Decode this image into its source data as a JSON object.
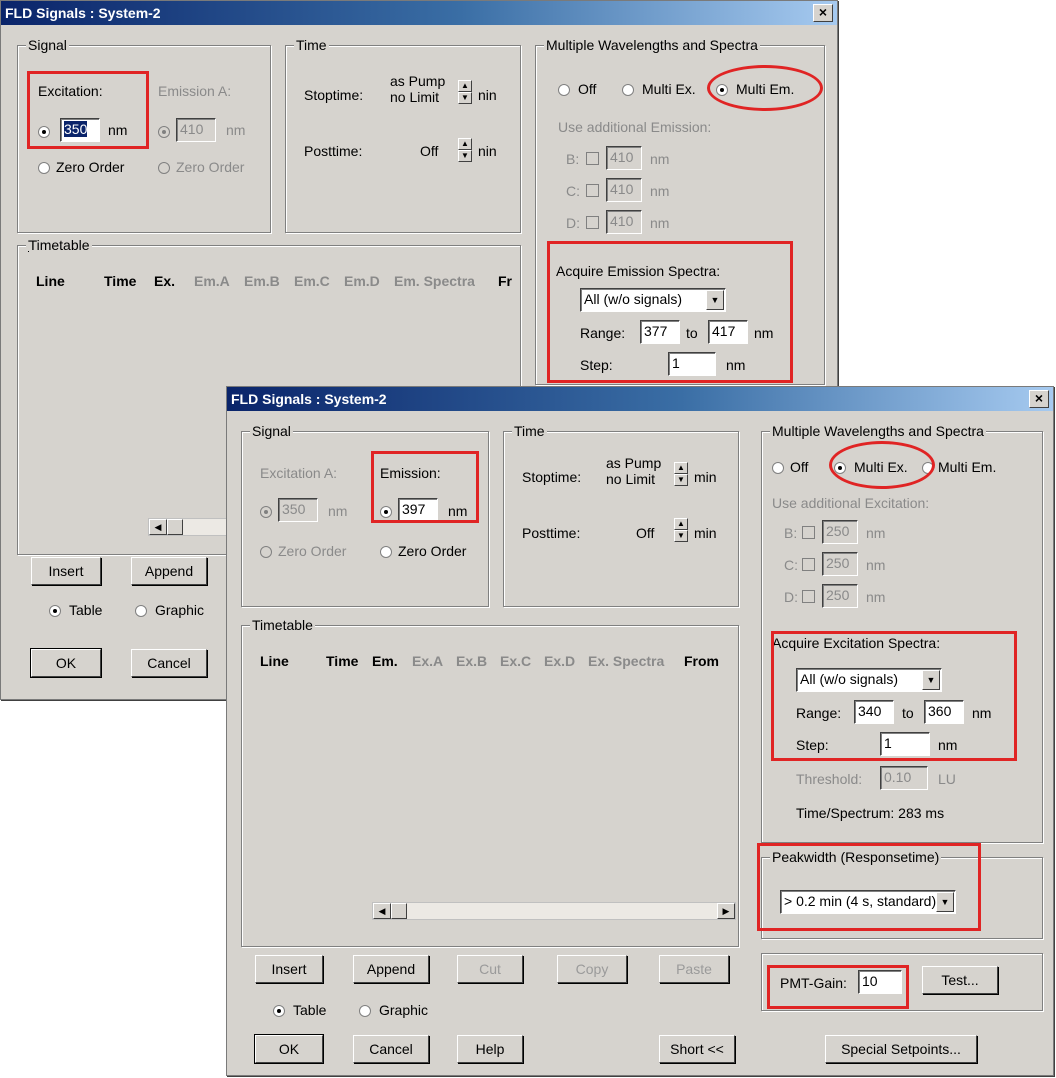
{
  "back_window": {
    "title": "FLD Signals : System-2",
    "close_glyph": "×",
    "signal": {
      "group": "Signal",
      "excitation_label": "Excitation:",
      "excitation_value": "350",
      "excitation_unit": "nm",
      "excitation_zero_order": "Zero Order",
      "emission_label": "Emission A:",
      "emission_value": "410",
      "emission_unit": "nm",
      "emission_zero_order": "Zero Order"
    },
    "time": {
      "group": "Time",
      "stoptime_label": "Stoptime:",
      "stoptime_value_1": "as Pump",
      "stoptime_value_2": "no Limit",
      "stoptime_unit": "nin",
      "posttime_label": "Posttime:",
      "posttime_value": "Off",
      "posttime_unit": "nin"
    },
    "multi": {
      "group": "Multiple Wavelengths and Spectra",
      "opt_off": "Off",
      "opt_multi_ex": "Multi Ex.",
      "opt_multi_em": "Multi Em.",
      "use_additional": "Use additional Emission:",
      "b_label": "B:",
      "c_label": "C:",
      "d_label": "D:",
      "b_value": "410",
      "c_value": "410",
      "d_value": "410",
      "unit": "nm",
      "acquire_label": "Acquire Emission Spectra:",
      "acquire_select": "All (w/o signals)",
      "range_label": "Range:",
      "range_from": "377",
      "range_to_label": "to",
      "range_to": "417",
      "range_unit": "nm",
      "step_label": "Step:",
      "step_value": "1",
      "step_unit": "nm"
    },
    "timetable": {
      "group": "Timetable",
      "columns": [
        "Line",
        "Time",
        "Ex.",
        "Em.A",
        "Em.B",
        "Em.C",
        "Em.D",
        "Em. Spectra",
        "Fr"
      ]
    },
    "buttons": {
      "insert": "Insert",
      "append": "Append",
      "ok": "OK",
      "cancel": "Cancel"
    },
    "view_table": "Table",
    "view_graphic": "Graphic"
  },
  "front_window": {
    "title": "FLD Signals : System-2",
    "close_glyph": "×",
    "signal": {
      "group": "Signal",
      "excitation_label": "Excitation A:",
      "excitation_value": "350",
      "excitation_unit": "nm",
      "excitation_zero_order": "Zero Order",
      "emission_label": "Emission:",
      "emission_value": "397",
      "emission_unit": "nm",
      "emission_zero_order": "Zero Order"
    },
    "time": {
      "group": "Time",
      "stoptime_label": "Stoptime:",
      "stoptime_value_1": "as Pump",
      "stoptime_value_2": "no Limit",
      "stoptime_unit": "min",
      "posttime_label": "Posttime:",
      "posttime_value": "Off",
      "posttime_unit": "min"
    },
    "multi": {
      "group": "Multiple Wavelengths and Spectra",
      "opt_off": "Off",
      "opt_multi_ex": "Multi Ex.",
      "opt_multi_em": "Multi Em.",
      "use_additional": "Use additional Excitation:",
      "b_label": "B:",
      "c_label": "C:",
      "d_label": "D:",
      "b_value": "250",
      "c_value": "250",
      "d_value": "250",
      "unit": "nm",
      "acquire_label": "Acquire Excitation Spectra:",
      "acquire_select": "All (w/o signals)",
      "range_label": "Range:",
      "range_from": "340",
      "range_to_label": "to",
      "range_to": "360",
      "range_unit": "nm",
      "step_label": "Step:",
      "step_value": "1",
      "step_unit": "nm",
      "threshold_label": "Threshold:",
      "threshold_value": "0.10",
      "threshold_unit": "LU",
      "time_per_spectrum": "Time/Spectrum: 283 ms"
    },
    "peakwidth": {
      "group": "Peakwidth (Responsetime)",
      "select": "> 0.2 min  (4 s, standard)"
    },
    "pmt": {
      "label": "PMT-Gain:",
      "value": "10",
      "test_button": "Test..."
    },
    "timetable": {
      "group": "Timetable",
      "columns": [
        "Line",
        "Time",
        "Em.",
        "Ex.A",
        "Ex.B",
        "Ex.C",
        "Ex.D",
        "Ex. Spectra",
        "From"
      ]
    },
    "buttons": {
      "insert": "Insert",
      "append": "Append",
      "cut": "Cut",
      "copy": "Copy",
      "paste": "Paste",
      "ok": "OK",
      "cancel": "Cancel",
      "help": "Help",
      "short": "Short <<",
      "special": "Special Setpoints..."
    },
    "view_table": "Table",
    "view_graphic": "Graphic"
  },
  "colors": {
    "dialog_face": "#d6d3ce",
    "title_gradient_start": "#0a246a",
    "title_gradient_end": "#a6caf0",
    "annotation_red": "#e02424"
  },
  "icons": [
    "close-icon",
    "spin-up-icon",
    "spin-down-icon",
    "dropdown-arrow-icon",
    "scroll-left-icon",
    "scroll-right-icon"
  ]
}
